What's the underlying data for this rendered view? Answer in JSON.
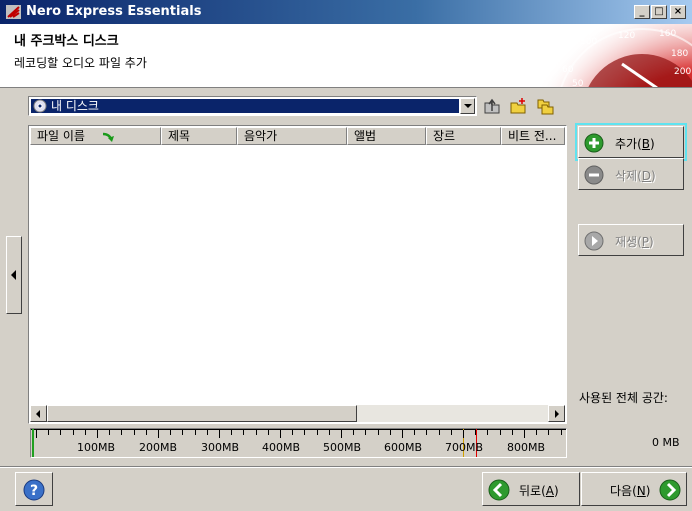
{
  "window": {
    "title": "Nero Express Essentials"
  },
  "header": {
    "title": "내 주크박스 디스크",
    "subtitle": "레코딩할 오디오 파일 추가"
  },
  "disc_selector": {
    "selected": "내 디스크"
  },
  "file_list": {
    "columns": [
      "파일 이름",
      "제목",
      "음악가",
      "앨범",
      "장르",
      "비트 전..."
    ],
    "rows": []
  },
  "capacity": {
    "labels": [
      "100MB",
      "200MB",
      "300MB",
      "400MB",
      "500MB",
      "600MB",
      "700MB",
      "800MB"
    ],
    "used_label": "사용된 전체 공간:",
    "used_value": "0 MB"
  },
  "buttons": {
    "add": {
      "text": "추가",
      "key": "B"
    },
    "delete": {
      "text": "삭제",
      "key": "D"
    },
    "play": {
      "text": "재생",
      "key": "P"
    },
    "back": {
      "text": "뒤로",
      "key": "A"
    },
    "next": {
      "text": "다음",
      "key": "N"
    }
  },
  "colors": {
    "titlebar": "#0a246a",
    "selection": "#0a246a",
    "focus": "#5fe3f0",
    "green": "#2e9a2e"
  }
}
